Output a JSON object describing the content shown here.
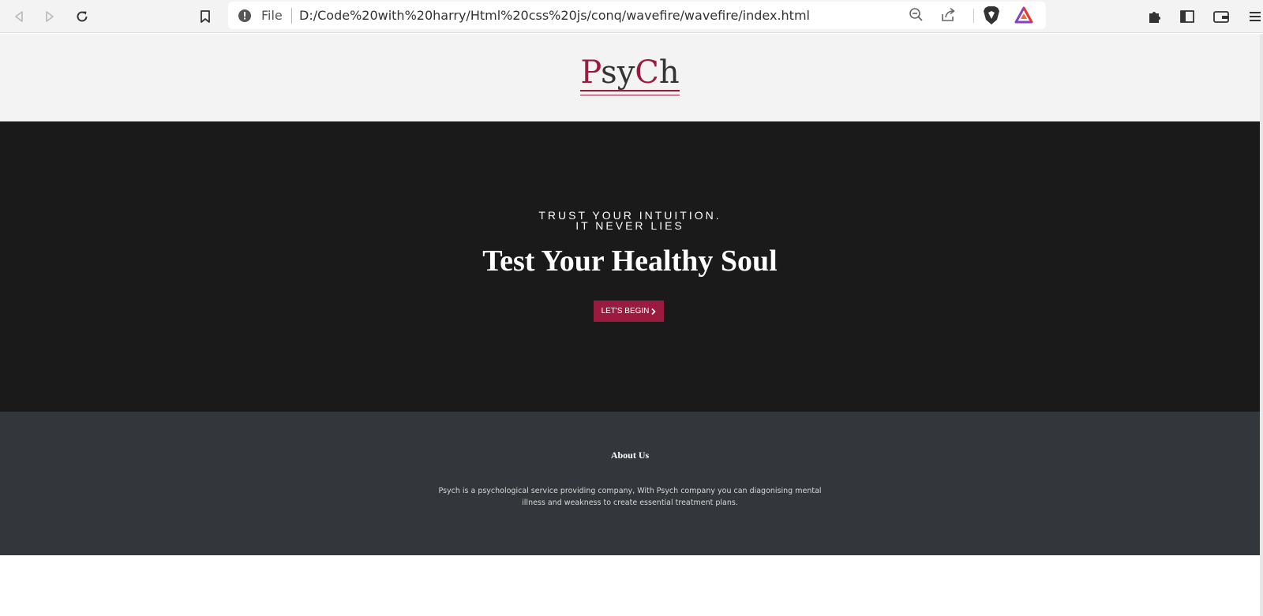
{
  "browser": {
    "url_scheme": "File",
    "url": "D:/Code%20with%20harry/Html%20css%20js/conq/wavefire/wavefire/index.html",
    "icons": [
      "back-icon",
      "forward-icon",
      "reload-icon",
      "bookmark-icon",
      "info-icon",
      "zoom-out-icon",
      "share-icon",
      "brave-shield-icon",
      "brave-rewards-icon",
      "extensions-icon",
      "sidebar-icon",
      "wallet-icon",
      "menu-icon"
    ]
  },
  "header": {
    "logo_parts": [
      "P",
      "sy",
      "C",
      "h"
    ],
    "logo_accent_color": "#9a1b3f"
  },
  "hero": {
    "tagline_line1": "TRUST YOUR INTUITION.",
    "tagline_line2": "IT NEVER LIES",
    "title": "Test Your Healthy Soul",
    "button_label": "LET'S BEGIN",
    "button_icon": "chevron-right-icon",
    "background_color": "#1a1a1a"
  },
  "about": {
    "title": "About Us",
    "text": "Psych is a psychological service providing company, With Psych company you can diagonising mental illness and weakness to create essential treatment plans.",
    "background_color": "#33363a"
  }
}
